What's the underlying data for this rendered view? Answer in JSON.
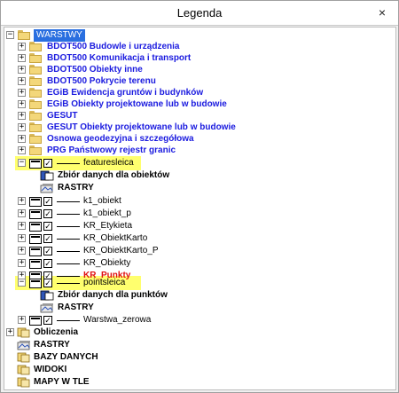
{
  "window": {
    "title": "Legenda",
    "close_glyph": "×"
  },
  "root": {
    "label": "WARSTWY"
  },
  "groups": [
    {
      "label": "BDOT500 Budowle i urządzenia"
    },
    {
      "label": "BDOT500 Komunikacja i transport"
    },
    {
      "label": "BDOT500 Obiekty inne"
    },
    {
      "label": "BDOT500 Pokrycie terenu"
    },
    {
      "label": "EGiB Ewidencja gruntów i budynków"
    },
    {
      "label": "EGiB Obiekty projektowane lub w budowie"
    },
    {
      "label": "GESUT"
    },
    {
      "label": "GESUT Obiekty projektowane lub w budowie"
    },
    {
      "label": "Osnowa geodezyjna i szczegółowa"
    },
    {
      "label": "PRG Państwowy rejestr granic"
    }
  ],
  "layers": [
    {
      "label": "featuresleica",
      "highlight": true,
      "children": [
        "Zbiór danych dla obiektów",
        "RASTRY"
      ]
    },
    {
      "label": "k1_obiekt"
    },
    {
      "label": "k1_obiekt_p"
    },
    {
      "label": "KR_Etykieta"
    },
    {
      "label": "KR_ObiektKarto"
    },
    {
      "label": "KR_ObiektKarto_P"
    },
    {
      "label": "KR_Obiekty"
    },
    {
      "label": "KR_Punkty",
      "red": true
    },
    {
      "label": "pointsleica",
      "highlight": true,
      "children": [
        "Zbiór danych dla punktów",
        "RASTRY"
      ]
    },
    {
      "label": "Warstwa_zerowa"
    }
  ],
  "bottom_items": [
    {
      "label": "Obliczenia",
      "expander": "+"
    },
    {
      "label": "RASTRY"
    },
    {
      "label": "BAZY DANYCH"
    },
    {
      "label": "WIDOKI"
    },
    {
      "label": "MAPY W TLE"
    }
  ],
  "colors": {
    "group_text": "#1a1adf",
    "highlight": "#ffff6e",
    "selection": "#2a6fe0",
    "red_layer": "#e01010"
  }
}
